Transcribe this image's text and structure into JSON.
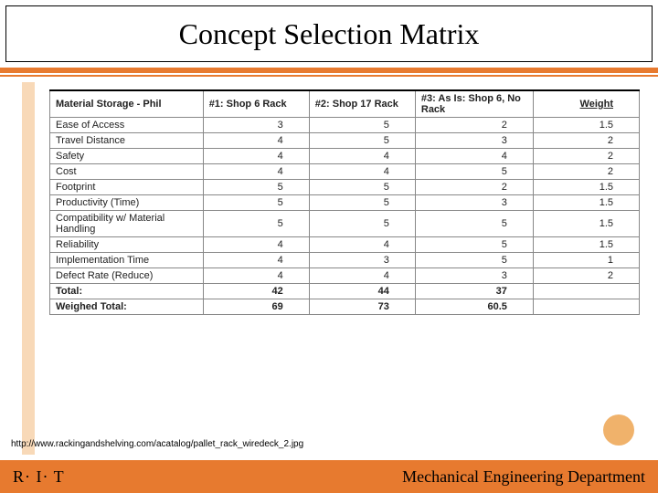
{
  "title": "Concept Selection Matrix",
  "chart_data": {
    "type": "table",
    "title": "Concept Selection Matrix",
    "header": {
      "criteria_label": "Material Storage - Phil",
      "concept1": "#1: Shop 6 Rack",
      "concept2": "#2: Shop 17 Rack",
      "concept3": "#3: As Is: Shop 6, No Rack",
      "weight_label": "Weight"
    },
    "rows": [
      {
        "criterion": "Ease of Access",
        "c1": "3",
        "c2": "5",
        "c3": "2",
        "w": "1.5"
      },
      {
        "criterion": "Travel Distance",
        "c1": "4",
        "c2": "5",
        "c3": "3",
        "w": "2"
      },
      {
        "criterion": "Safety",
        "c1": "4",
        "c2": "4",
        "c3": "4",
        "w": "2"
      },
      {
        "criterion": "Cost",
        "c1": "4",
        "c2": "4",
        "c3": "5",
        "w": "2"
      },
      {
        "criterion": "Footprint",
        "c1": "5",
        "c2": "5",
        "c3": "2",
        "w": "1.5"
      },
      {
        "criterion": "Productivity (Time)",
        "c1": "5",
        "c2": "5",
        "c3": "3",
        "w": "1.5"
      },
      {
        "criterion": "Compatibility w/ Material Handling",
        "c1": "5",
        "c2": "5",
        "c3": "5",
        "w": "1.5"
      },
      {
        "criterion": "Reliability",
        "c1": "4",
        "c2": "4",
        "c3": "5",
        "w": "1.5"
      },
      {
        "criterion": "Implementation Time",
        "c1": "4",
        "c2": "3",
        "c3": "5",
        "w": "1"
      },
      {
        "criterion": "Defect Rate (Reduce)",
        "c1": "4",
        "c2": "4",
        "c3": "3",
        "w": "2"
      }
    ],
    "totals": {
      "label": "Total:",
      "c1": "42",
      "c2": "44",
      "c3": "37",
      "w": ""
    },
    "weighted": {
      "label": "Weighed Total:",
      "c1": "69",
      "c2": "73",
      "c3": "60.5",
      "w": ""
    }
  },
  "source_url": "http://www.rackingandshelving.com/acatalog/pallet_rack_wiredeck_2.jpg",
  "footer": {
    "left": "R· I· T",
    "right": "Mechanical Engineering Department"
  }
}
